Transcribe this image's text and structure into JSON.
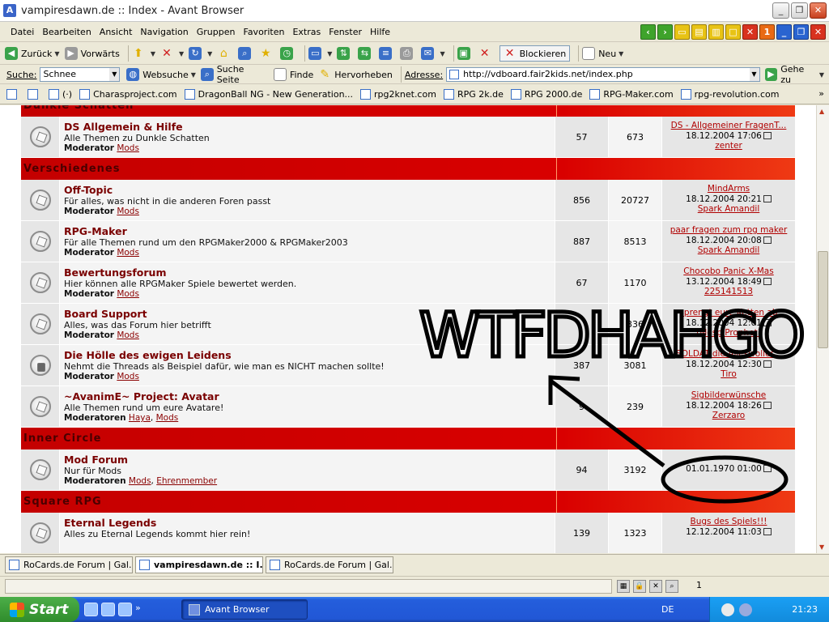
{
  "window": {
    "title": "vampiresdawn.de :: Index - Avant Browser"
  },
  "menu": [
    "Datei",
    "Bearbeiten",
    "Ansicht",
    "Navigation",
    "Gruppen",
    "Favoriten",
    "Extras",
    "Fenster",
    "Hilfe"
  ],
  "menu_right_badge": "1",
  "toolbar": {
    "back": "Zurück",
    "forward": "Vorwärts",
    "block": "Blockieren",
    "new": "Neu"
  },
  "addressbar": {
    "search_label": "Suche:",
    "search_value": "Schnee",
    "websearch": "Websuche",
    "search_page": "Suche Seite",
    "find": "Finde",
    "highlight": "Hervorheben",
    "address_label": "Adresse:",
    "url": "http://vdboard.fair2kids.net/index.php",
    "go": "Gehe zu"
  },
  "links": [
    "(·)",
    "Charasproject.com",
    "DragonBall NG - New Generation...",
    "rpg2knet.com",
    "RPG 2k.de",
    "RPG 2000.de",
    "RPG-Maker.com",
    "rpg-revolution.com"
  ],
  "links_more": "»",
  "forum": {
    "sections": [
      {
        "title": "Dunkle Schatten",
        "forums": [
          {
            "name": "DS Allgemein & Hilfe",
            "desc": "Alle Themen zu Dunkle Schatten",
            "mod_label": "Moderator",
            "mods": [
              "Mods"
            ],
            "topics": "57",
            "posts": "673",
            "last_title": "DS - Allgemeiner FragenT...",
            "last_date": "18.12.2004 17:06",
            "last_user": "zenter",
            "locked": false
          }
        ]
      },
      {
        "title": "Verschiedenes",
        "forums": [
          {
            "name": "Off-Topic",
            "desc": "Für alles, was nicht in die anderen Foren passt",
            "mod_label": "Moderator",
            "mods": [
              "Mods"
            ],
            "topics": "856",
            "posts": "20727",
            "last_title": "MindArms",
            "last_date": "18.12.2004 20:21",
            "last_user": "Spark Amandil",
            "locked": false
          },
          {
            "name": "RPG-Maker",
            "desc": "Für alle Themen rund um den RPGMaker2000 & RPGMaker2003",
            "mod_label": "Moderator",
            "mods": [
              "Mods"
            ],
            "topics": "887",
            "posts": "8513",
            "last_title": "paar fragen zum rpg maker",
            "last_date": "18.12.2004 20:08",
            "last_user": "Spark Amandil",
            "locked": false
          },
          {
            "name": "Bewertungsforum",
            "desc": "Hier können alle RPGMaker Spiele bewertet werden.",
            "mod_label": "Moderator",
            "mods": [
              "Mods"
            ],
            "topics": "67",
            "posts": "1170",
            "last_title": "Chocobo Panic X-Mas",
            "last_date": "13.12.2004 18:49",
            "last_user": "225141513",
            "locked": false
          },
          {
            "name": "Board Support",
            "desc": "Alles, was das Forum hier betrifft",
            "mod_label": "Moderator",
            "mods": [
              "Mods"
            ],
            "topics": "",
            "posts": "336",
            "last_title": "sprengt eure Ketten ab",
            "last_date": "18.12.2004 12:01",
            "last_user": "[Mosp Prophet]",
            "locked": false
          },
          {
            "name": "Die Hölle des ewigen Leidens",
            "desc": "Nehmt die Threads als Beispiel dafür, wie man es NICHT machen sollte!",
            "mod_label": "Moderator",
            "mods": [
              "Mods"
            ],
            "topics": "387",
            "posts": "3081",
            "last_title": "SOLDAT die Alleswoller...",
            "last_date": "18.12.2004 12:30",
            "last_user": "Tiro",
            "locked": true
          },
          {
            "name": "~AvanimE~ Project: Avatar",
            "desc": "Alle Themen rund um eure Avatare!",
            "mod_label": "Moderatoren",
            "mods": [
              "Haya",
              "Mods"
            ],
            "topics": "9",
            "posts": "239",
            "last_title": "Sigbilderwünsche",
            "last_date": "18.12.2004 18:26",
            "last_user": "Zerzaro",
            "locked": false
          }
        ]
      },
      {
        "title": "Inner Circle",
        "forums": [
          {
            "name": "Mod Forum",
            "desc": "Nur für Mods",
            "mod_label": "Moderatoren",
            "mods": [
              "Mods",
              "Ehrenmember"
            ],
            "topics": "94",
            "posts": "3192",
            "last_title": "",
            "last_date": "01.01.1970 01:00",
            "last_user": "",
            "locked": false
          }
        ]
      },
      {
        "title": "Square RPG",
        "forums": [
          {
            "name": "Eternal Legends",
            "desc": "Alles zu Eternal Legends kommt hier rein!",
            "mod_label": "",
            "mods": [],
            "topics": "139",
            "posts": "1323",
            "last_title": "Bugs des Spiels!!!",
            "last_date": "12.12.2004 11:03",
            "last_user": "",
            "locked": false
          }
        ]
      }
    ]
  },
  "scribble_text": "WTFDHAHGO",
  "tabs": [
    {
      "label": "RoCards.de Forum | Gal...",
      "active": false
    },
    {
      "label": "vampiresdawn.de :: I...",
      "active": true
    },
    {
      "label": "RoCards.de Forum | Gal...",
      "active": false
    }
  ],
  "status": {
    "text": "",
    "count": "1"
  },
  "taskbar": {
    "start": "Start",
    "task": "Avant Browser",
    "lang": "DE",
    "clock": "21:23"
  }
}
